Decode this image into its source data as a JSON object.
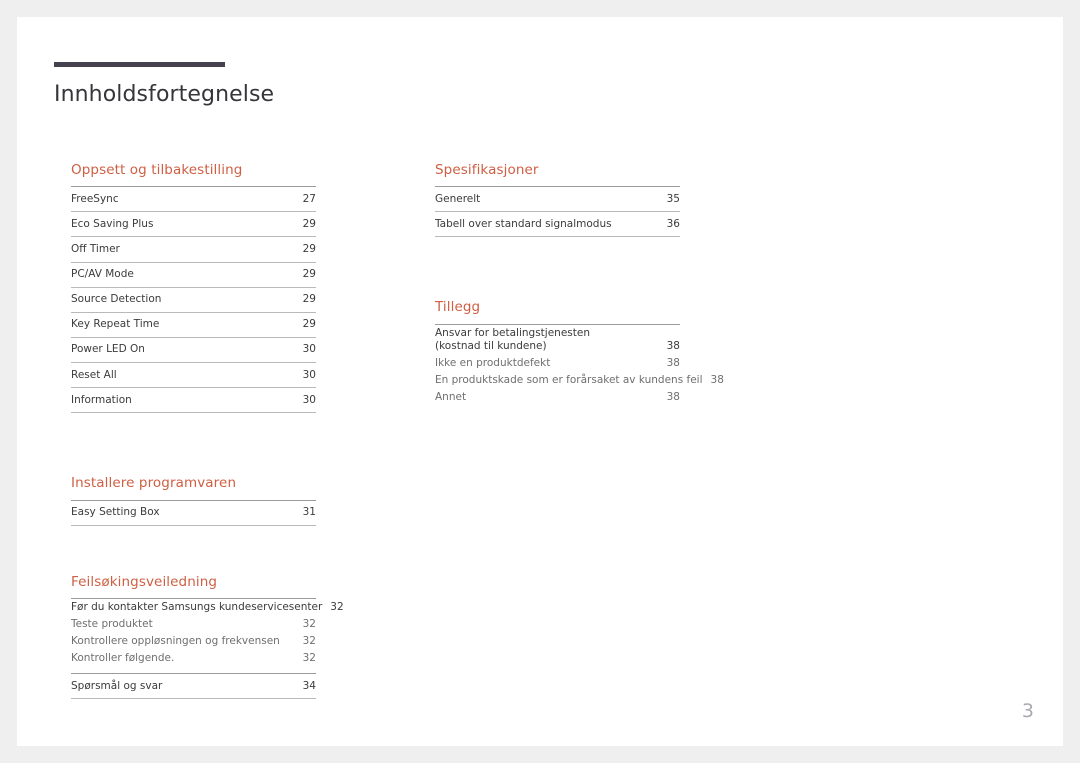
{
  "document": {
    "title": "Innholdsfortegnelse",
    "page_number": "3",
    "accent_color": "#cf5f43",
    "title_rule_color": "#46414f",
    "text_color": "#3b3b3b",
    "subentry_color": "#6f6f6f",
    "page_number_color": "#a9a9b2",
    "page_background": "#ffffff",
    "canvas_background": "#f0efef"
  },
  "left_column": {
    "sections": [
      {
        "heading": "Oppsett og tilbakestilling",
        "entries": [
          {
            "label": "FreeSync",
            "page": "27"
          },
          {
            "label": "Eco Saving Plus",
            "page": "29"
          },
          {
            "label": "Off Timer",
            "page": "29"
          },
          {
            "label": "PC/AV Mode",
            "page": "29"
          },
          {
            "label": "Source Detection",
            "page": "29"
          },
          {
            "label": "Key Repeat Time",
            "page": "29"
          },
          {
            "label": "Power LED On",
            "page": "30"
          },
          {
            "label": "Reset All",
            "page": "30"
          },
          {
            "label": "Information",
            "page": "30"
          }
        ]
      },
      {
        "heading": "Installere programvaren",
        "entries": [
          {
            "label": "Easy Setting Box",
            "page": "31"
          }
        ]
      },
      {
        "heading": "Feilsøkingsveiledning",
        "entries": [
          {
            "label": "Før du kontakter Samsungs kundeservicesenter",
            "page": "32"
          },
          {
            "label": "Teste produktet",
            "page": "32"
          },
          {
            "label": "Kontrollere oppløsningen og frekvensen",
            "page": "32"
          },
          {
            "label": "Kontroller følgende.",
            "page": "32"
          },
          {
            "label": "Spørsmål og svar",
            "page": "34"
          }
        ]
      }
    ]
  },
  "right_column": {
    "sections": [
      {
        "heading": "Spesifikasjoner",
        "entries": [
          {
            "label": "Generelt",
            "page": "35"
          },
          {
            "label": "Tabell over standard signalmodus",
            "page": "36"
          }
        ]
      },
      {
        "heading": "Tillegg",
        "entries": [
          {
            "label_line1": "Ansvar for betalingstjenesten",
            "label_line2": "(kostnad til kundene)",
            "page": "38"
          },
          {
            "label": "Ikke en produktdefekt",
            "page": "38"
          },
          {
            "label": "En produktskade som er forårsaket av kundens feil",
            "page": "38"
          },
          {
            "label": "Annet",
            "page": "38"
          }
        ]
      }
    ]
  }
}
